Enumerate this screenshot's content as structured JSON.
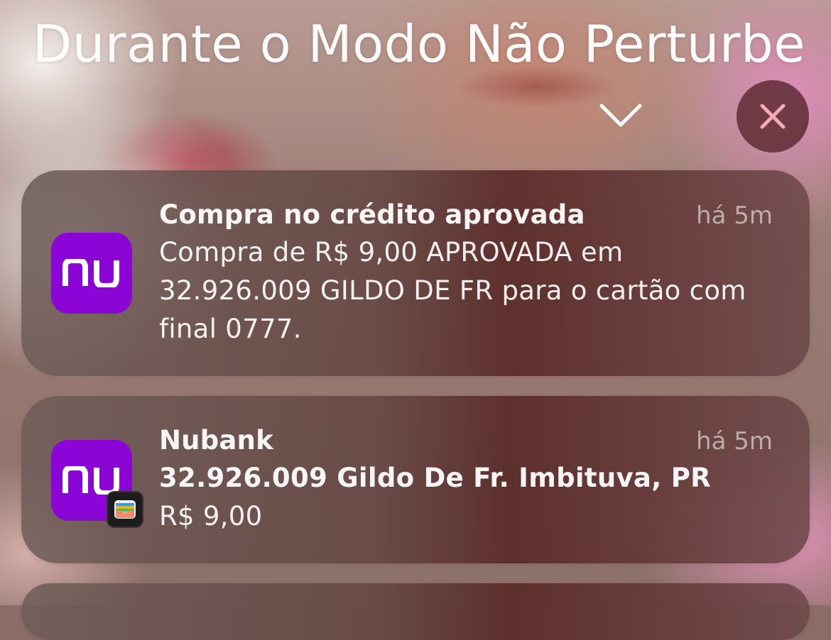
{
  "header": {
    "title": "Durante o Modo Não Perturbe",
    "collapse_icon": "chevron-down-icon",
    "close_icon": "close-icon"
  },
  "colors": {
    "nubank_purple": "#8a05d6",
    "close_button_bg": "#5a282e"
  },
  "notifications": [
    {
      "app_icon": "nubank-app-icon",
      "icon_text": "nu",
      "title": "Compra no crédito aprovada",
      "time": "há 5m",
      "body": "Compra de R$ 9,00 APROVADA em 32.926.009 GILDO DE FR para o cartão com final 0777."
    },
    {
      "app_icon": "nubank-app-icon",
      "icon_text": "nu",
      "badge_icon": "wallet-icon",
      "title": "Nubank",
      "time": "há 5m",
      "subtitle": "32.926.009 Gildo De Fr. Imbituva, PR",
      "body": "R$ 9,00"
    }
  ]
}
